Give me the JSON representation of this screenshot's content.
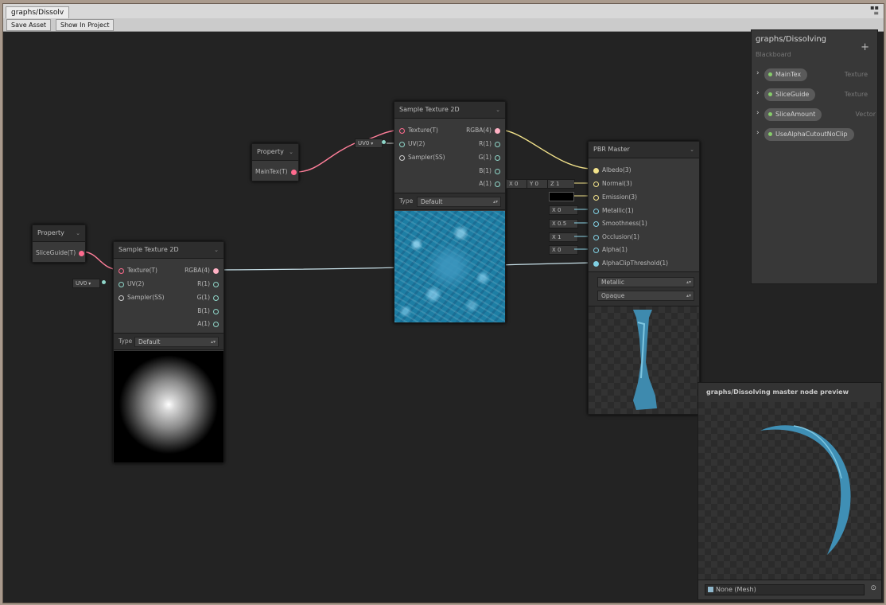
{
  "window": {
    "tab_title": "graphs/Dissolv"
  },
  "toolbar": {
    "save_asset": "Save Asset",
    "show_in_project": "Show In Project"
  },
  "property_main": {
    "title": "Property",
    "output": "MainTex(T)"
  },
  "property_slice": {
    "title": "Property",
    "output": "SliceGuide(T)"
  },
  "uv_field_top": "UV0",
  "uv_field_left": "UV0",
  "sample_top": {
    "title": "Sample Texture 2D",
    "inputs": [
      "Texture(T)",
      "UV(2)",
      "Sampler(SS)"
    ],
    "outputs": [
      "RGBA(4)",
      "R(1)",
      "G(1)",
      "B(1)",
      "A(1)"
    ],
    "type_label": "Type",
    "type_value": "Default"
  },
  "sample_left": {
    "title": "Sample Texture 2D",
    "inputs": [
      "Texture(T)",
      "UV(2)",
      "Sampler(SS)"
    ],
    "outputs": [
      "RGBA(4)",
      "R(1)",
      "G(1)",
      "B(1)",
      "A(1)"
    ],
    "type_label": "Type",
    "type_value": "Default"
  },
  "pbr": {
    "title": "PBR Master",
    "inputs": [
      "Albedo(3)",
      "Normal(3)",
      "Emission(3)",
      "Metallic(1)",
      "Smoothness(1)",
      "Occlusion(1)",
      "Alpha(1)",
      "AlphaClipThreshold(1)"
    ],
    "normal_fields": [
      "X 0",
      "Y 0",
      "Z 1"
    ],
    "metallic_field": "X 0",
    "smoothness_field": "X 0.5",
    "occlusion_field": "X 1",
    "alpha_field": "X 0",
    "workflow": "Metallic",
    "surface": "Opaque"
  },
  "blackboard": {
    "title": "graphs/Dissolving",
    "subtitle": "Blackboard",
    "add_icon": "+",
    "properties": [
      {
        "name": "MainTex",
        "type": "Texture"
      },
      {
        "name": "SliceGuide",
        "type": "Texture"
      },
      {
        "name": "SliceAmount",
        "type": "Vector"
      },
      {
        "name": "UseAlphaCutoutNoClip",
        "type": ""
      }
    ]
  },
  "preview": {
    "title": "graphs/Dissolving master node preview",
    "mesh": "None (Mesh)"
  },
  "colors": {
    "texture_wire": "#ff7f9a",
    "vector3_wire": "#f3e38b",
    "vector1_wire": "#8fd6e8",
    "pbr_blue": "#3f8fb5"
  }
}
